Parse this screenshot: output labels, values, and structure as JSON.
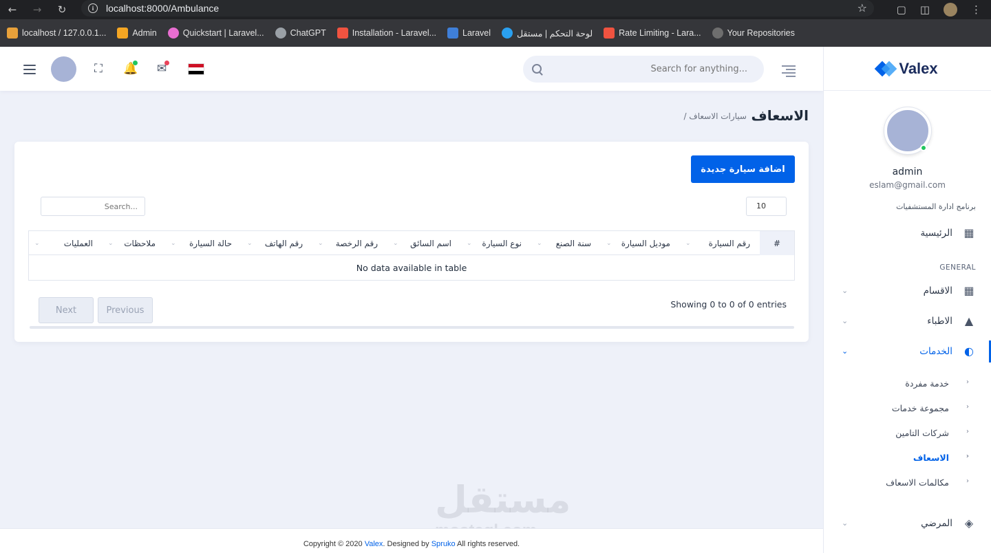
{
  "browser": {
    "url": "localhost:8000/Ambulance",
    "bookmarks": [
      {
        "label": "localhost / 127.0.0.1...",
        "color": "#e8a13a"
      },
      {
        "label": "Admin",
        "color": "#f5a623"
      },
      {
        "label": "Quickstart | Laravel...",
        "color": "#e86ed1"
      },
      {
        "label": "ChatGPT",
        "color": "#9aa0a6"
      },
      {
        "label": "Installation - Laravel...",
        "color": "#f05340"
      },
      {
        "label": "Laravel",
        "color": "#3f7fd8"
      },
      {
        "label": "لوحة التحكم | مستقل",
        "color": "#2aa0f0"
      },
      {
        "label": "Rate Limiting - Lara...",
        "color": "#f05340"
      },
      {
        "label": "Your Repositories",
        "color": "#6e6e6e"
      }
    ]
  },
  "header": {
    "search_placeholder": "Search for anything...",
    "flag_colors": [
      "#ce1126",
      "#ffffff",
      "#000000"
    ],
    "notification_dot_color": "#22c55e",
    "mail_dot_color": "#e9435a"
  },
  "sidebar": {
    "logo_text": "Valex",
    "profile_name": "admin",
    "profile_email": "eslam@gmail.com",
    "app_name": "برنامج ادارة المستشفيات",
    "home_label": "الرئيسية",
    "section_general": "GENERAL",
    "menu": {
      "departments": "الاقسام",
      "doctors": "الاطباء",
      "services": "الخدمات",
      "patients": "المرضي"
    },
    "sub_items": {
      "single_service": "خدمة مفردة",
      "service_group": "مجموعة خدمات",
      "insurance": "شركات التامين",
      "ambulance": "الاسعاف",
      "ambulance_calls": "مكالمات الاسعاف"
    }
  },
  "page": {
    "title": "الاسعاف",
    "breadcrumb": "/ سيارات الاسعاف",
    "add_button": "اضافة سيارة جديدة",
    "page_length": "10",
    "table_search_placeholder": "Search...",
    "columns": [
      "#",
      "رقم السيارة",
      "موديل السيارة",
      "سنة الصنع",
      "نوع السيارة",
      "اسم السائق",
      "رقم الرخصة",
      "رقم الهاتف",
      "حالة السيارة",
      "ملاحظات",
      "العمليات"
    ],
    "empty_message": "No data available in table",
    "info": "Showing 0 to 0 of 0 entries",
    "previous": "Previous",
    "next": "Next",
    "accent_color": "#0162e8"
  },
  "footer": {
    "prefix": "Copyright © 2020 ",
    "brand": "Valex",
    "middle": ". Designed by ",
    "designer": "Spruko",
    "suffix": " All rights reserved."
  },
  "watermark": {
    "arabic": "مستقل",
    "latin": "mostaql.com"
  }
}
